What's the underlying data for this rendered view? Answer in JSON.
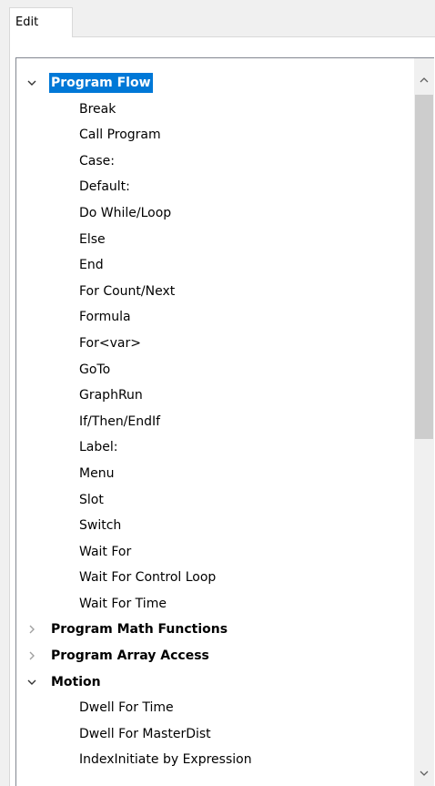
{
  "tabs": [
    {
      "label": "Edit"
    }
  ],
  "tree": {
    "groups": [
      {
        "label": "Program Flow",
        "expanded": true,
        "selected": true,
        "items": [
          "Break",
          "Call Program",
          "Case:",
          "Default:",
          "Do While/Loop",
          "Else",
          "End",
          "For Count/Next",
          "Formula",
          "For<var>",
          "GoTo",
          "GraphRun",
          "If/Then/EndIf",
          "Label:",
          "Menu",
          "Slot",
          "Switch",
          "Wait For",
          "Wait For Control Loop",
          "Wait For Time"
        ]
      },
      {
        "label": "Program Math Functions",
        "expanded": false,
        "items": []
      },
      {
        "label": "Program Array Access",
        "expanded": false,
        "items": []
      },
      {
        "label": "Motion",
        "expanded": true,
        "items": [
          "Dwell For Time",
          "Dwell For MasterDist",
          "IndexInitiate by Expression"
        ]
      }
    ]
  },
  "colors": {
    "selection": "#0078d7",
    "scroll_thumb": "#cdcdcd"
  },
  "icons": {
    "expanded": "chevron-down-icon",
    "collapsed": "chevron-right-icon",
    "scroll_up": "scroll-up-arrow-icon",
    "scroll_down": "scroll-down-arrow-icon"
  }
}
